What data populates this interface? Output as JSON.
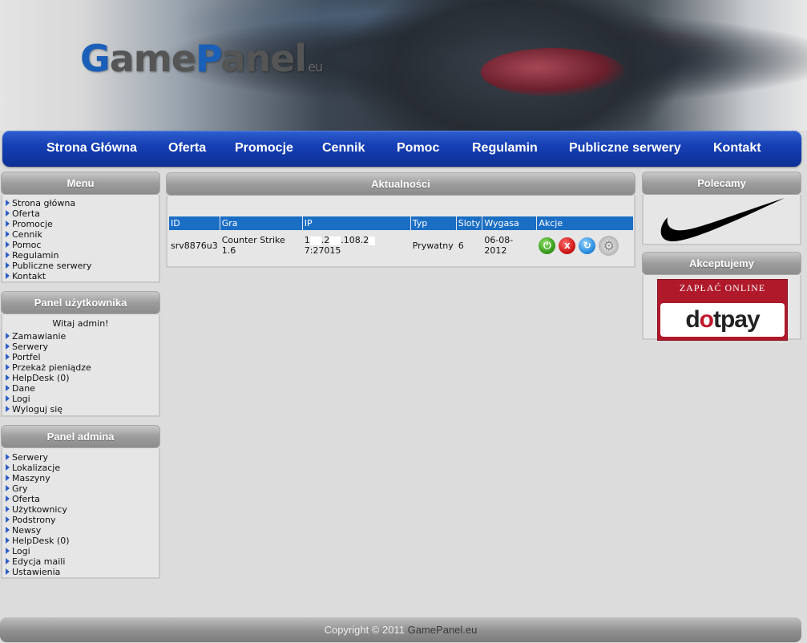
{
  "logo": {
    "part1_initial": "G",
    "part1_rest": "ame",
    "part2_initial": "P",
    "part2_rest": "anel",
    "suffix": "eu"
  },
  "nav": {
    "items": [
      "Strona Główna",
      "Oferta",
      "Promocje",
      "Cennik",
      "Pomoc",
      "Regulamin",
      "Publiczne serwery",
      "Kontakt"
    ]
  },
  "menu": {
    "title": "Menu",
    "items": [
      "Strona główna",
      "Oferta",
      "Promocje",
      "Cennik",
      "Pomoc",
      "Regulamin",
      "Publiczne serwery",
      "Kontakt"
    ]
  },
  "user_panel": {
    "title": "Panel użytkownika",
    "welcome": "Witaj admin!",
    "items": [
      "Zamawianie",
      "Serwery",
      "Portfel",
      "Przekaż pieniądze",
      "HelpDesk (0)",
      "Dane",
      "Logi",
      "Wyloguj się"
    ]
  },
  "admin_panel": {
    "title": "Panel admina",
    "items": [
      "Serwery",
      "Lokalizacje",
      "Maszyny",
      "Gry",
      "Oferta",
      "Użytkownicy",
      "Podstrony",
      "Newsy",
      "HelpDesk (0)",
      "Logi",
      "Edycja maili",
      "Ustawienia"
    ]
  },
  "news": {
    "title": "Aktualności",
    "table": {
      "headers": [
        "ID",
        "Gra",
        "IP",
        "Typ",
        "Sloty",
        "Wygasa",
        "Akcje"
      ],
      "rows": [
        {
          "id": "srv8876u3",
          "game": "Counter Strike 1.6",
          "ip_a": "1",
          "ip_b": ".2",
          "ip_c": ".108.2",
          "ip_d": "7:27015",
          "type": "Prywatny",
          "slots": "6",
          "expires": "06-08-2012"
        }
      ]
    },
    "action_icons": [
      "power-icon",
      "stop-icon",
      "restart-icon",
      "settings-icon"
    ]
  },
  "recommend": {
    "title": "Polecamy",
    "logo_icon": "nike-swoosh-icon"
  },
  "accept": {
    "title": "Akceptujemy",
    "top_text": "ZAPŁAĆ ONLINE",
    "brand_dot": "d",
    "brand_o": "o",
    "brand_rest": "tpay"
  },
  "footer": {
    "copyright": "Copyright © 2011",
    "brand": "GamePanel.eu"
  },
  "colors": {
    "nav_blue": "#1640b5",
    "table_header": "#1a6ec4",
    "bullet": "#2c5fc5",
    "dotpay_red": "#b0192a"
  }
}
